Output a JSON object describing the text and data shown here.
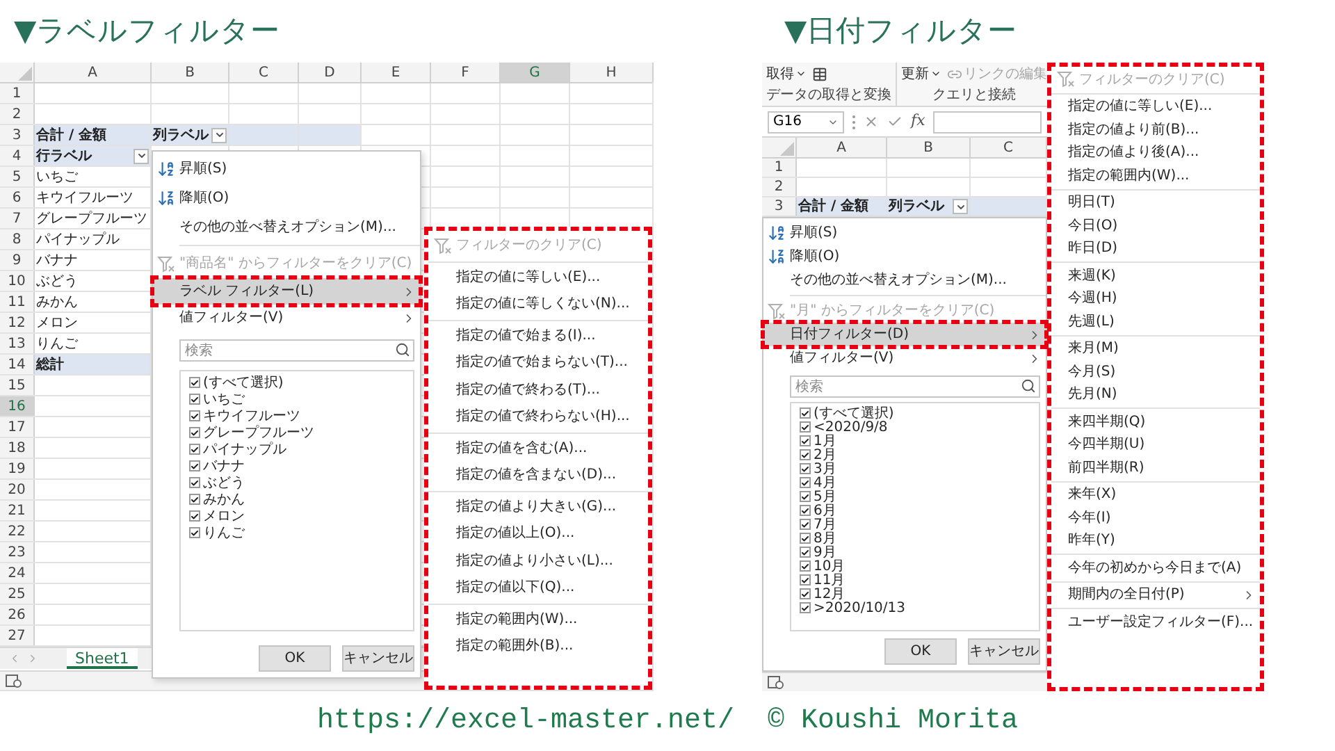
{
  "panels": [
    {
      "title": "▼ラベルフィルター",
      "columns": [
        {
          "label": "A",
          "selected": false
        },
        {
          "label": "B",
          "selected": false
        },
        {
          "label": "C",
          "selected": false
        },
        {
          "label": "D",
          "selected": false
        },
        {
          "label": "E",
          "selected": false
        },
        {
          "label": "F",
          "selected": false
        },
        {
          "label": "G",
          "selected": true
        },
        {
          "label": "H",
          "selected": false
        }
      ],
      "rows": [
        {
          "number": "1",
          "selected": false,
          "kind": "blank",
          "cells": []
        },
        {
          "number": "2",
          "selected": false,
          "kind": "blank",
          "cells": []
        },
        {
          "number": "3",
          "selected": false,
          "kind": "column_header",
          "cells": [
            {
              "text": "合計 / 金額",
              "dropdown": false
            },
            {
              "text": "列ラベル",
              "dropdown": true
            }
          ]
        },
        {
          "number": "4",
          "selected": false,
          "kind": "row_header",
          "cells": [
            {
              "text": "行ラベル",
              "dropdown": true
            }
          ]
        },
        {
          "number": "5",
          "selected": false,
          "kind": "item",
          "cells": [
            {
              "text": "いちご",
              "dropdown": false
            }
          ]
        },
        {
          "number": "6",
          "selected": false,
          "kind": "item",
          "cells": [
            {
              "text": "キウイフルーツ",
              "dropdown": false
            }
          ]
        },
        {
          "number": "7",
          "selected": false,
          "kind": "item",
          "cells": [
            {
              "text": "グレープフルーツ",
              "dropdown": false
            }
          ]
        },
        {
          "number": "8",
          "selected": false,
          "kind": "item",
          "cells": [
            {
              "text": "パイナップル",
              "dropdown": false
            }
          ]
        },
        {
          "number": "9",
          "selected": false,
          "kind": "item",
          "cells": [
            {
              "text": "バナナ",
              "dropdown": false
            }
          ]
        },
        {
          "number": "10",
          "selected": false,
          "kind": "item",
          "cells": [
            {
              "text": "ぶどう",
              "dropdown": false
            }
          ]
        },
        {
          "number": "11",
          "selected": false,
          "kind": "item",
          "cells": [
            {
              "text": "みかん",
              "dropdown": false
            }
          ]
        },
        {
          "number": "12",
          "selected": false,
          "kind": "item",
          "cells": [
            {
              "text": "メロン",
              "dropdown": false
            }
          ]
        },
        {
          "number": "13",
          "selected": false,
          "kind": "item",
          "cells": [
            {
              "text": "りんご",
              "dropdown": false
            }
          ]
        },
        {
          "number": "14",
          "selected": false,
          "kind": "total",
          "cells": [
            {
              "text": "総計",
              "dropdown": false
            }
          ]
        },
        {
          "number": "15",
          "selected": false,
          "kind": "blank",
          "cells": []
        },
        {
          "number": "16",
          "selected": true,
          "kind": "blank",
          "cells": []
        },
        {
          "number": "17",
          "selected": false,
          "kind": "blank",
          "cells": []
        },
        {
          "number": "18",
          "selected": false,
          "kind": "blank",
          "cells": []
        },
        {
          "number": "19",
          "selected": false,
          "kind": "blank",
          "cells": []
        },
        {
          "number": "20",
          "selected": false,
          "kind": "blank",
          "cells": []
        },
        {
          "number": "21",
          "selected": false,
          "kind": "blank",
          "cells": []
        },
        {
          "number": "22",
          "selected": false,
          "kind": "blank",
          "cells": []
        },
        {
          "number": "23",
          "selected": false,
          "kind": "blank",
          "cells": []
        },
        {
          "number": "24",
          "selected": false,
          "kind": "blank",
          "cells": []
        },
        {
          "number": "25",
          "selected": false,
          "kind": "blank",
          "cells": []
        },
        {
          "number": "26",
          "selected": false,
          "kind": "blank",
          "cells": []
        },
        {
          "number": "27",
          "selected": false,
          "kind": "blank",
          "cells": []
        }
      ],
      "sheet_tabs": [
        {
          "label": "Sheet1",
          "selected": true
        }
      ],
      "menu": {
        "sort_items": [
          {
            "kind": "ascending",
            "label": "昇順(S)"
          },
          {
            "kind": "descending",
            "label": "降順(O)"
          },
          {
            "kind": "option",
            "label": "その他の並べ替えオプション(M)..."
          }
        ],
        "clear": {
          "label": "\"商品名\" からフィルターをクリア(C)",
          "disabled": true
        },
        "filters": [
          {
            "label": "ラベル フィルター(L)",
            "selected": true
          },
          {
            "label": "値フィルター(V)",
            "selected": false
          }
        ],
        "search": {
          "placeholder": "検索"
        },
        "values": [
          {
            "label": "(すべて選択)",
            "checked": true
          },
          {
            "label": "いちご",
            "checked": true
          },
          {
            "label": "キウイフルーツ",
            "checked": true
          },
          {
            "label": "グレープフルーツ",
            "checked": true
          },
          {
            "label": "パイナップル",
            "checked": true
          },
          {
            "label": "バナナ",
            "checked": true
          },
          {
            "label": "ぶどう",
            "checked": true
          },
          {
            "label": "みかん",
            "checked": true
          },
          {
            "label": "メロン",
            "checked": true
          },
          {
            "label": "りんご",
            "checked": true
          }
        ],
        "buttons": [
          "OK",
          "キャンセル"
        ]
      },
      "submenu": {
        "clear": {
          "label": "フィルターのクリア(C)",
          "disabled": true
        },
        "groups": [
          [
            {
              "label": "指定の値に等しい(E)...",
              "kind": "item"
            },
            {
              "label": "指定の値に等しくない(N)...",
              "kind": "item"
            }
          ],
          [
            {
              "label": "指定の値で始まる(I)...",
              "kind": "item"
            },
            {
              "label": "指定の値で始まらない(T)...",
              "kind": "item"
            },
            {
              "label": "指定の値で終わる(T)...",
              "kind": "item"
            },
            {
              "label": "指定の値で終わらない(H)...",
              "kind": "item"
            }
          ],
          [
            {
              "label": "指定の値を含む(A)...",
              "kind": "item"
            },
            {
              "label": "指定の値を含まない(D)...",
              "kind": "item"
            }
          ],
          [
            {
              "label": "指定の値より大きい(G)...",
              "kind": "item"
            },
            {
              "label": "指定の値以上(O)...",
              "kind": "item"
            },
            {
              "label": "指定の値より小さい(L)...",
              "kind": "item"
            },
            {
              "label": "指定の値以下(Q)...",
              "kind": "item"
            }
          ],
          [
            {
              "label": "指定の範囲内(W)...",
              "kind": "item"
            },
            {
              "label": "指定の範囲外(B)...",
              "kind": "item"
            }
          ]
        ]
      }
    },
    {
      "title": "▼日付フィルター",
      "ribbon": {
        "groups": [
          {
            "label": "データの取得と変換",
            "buttons": [
              {
                "kind": "dropdown",
                "label": "取得",
                "disabled": false
              },
              {
                "kind": "table",
                "disabled": false
              }
            ]
          },
          {
            "label": "クエリと接続",
            "buttons": [
              {
                "kind": "dropdown",
                "label": "更新",
                "disabled": false
              },
              {
                "kind": "link",
                "label": "リンクの編集",
                "disabled": true
              }
            ]
          }
        ]
      },
      "formula_bar": {
        "name_box": "G16",
        "function_label": "fx"
      },
      "columns": [
        {
          "label": "A",
          "selected": false
        },
        {
          "label": "B",
          "selected": false
        },
        {
          "label": "C",
          "selected": false
        }
      ],
      "rows": [
        {
          "number": "1",
          "selected": false,
          "kind": "blank",
          "cells": []
        },
        {
          "number": "2",
          "selected": false,
          "kind": "blank",
          "cells": []
        },
        {
          "number": "3",
          "selected": false,
          "kind": "column_header",
          "cells": [
            {
              "text": "合計 / 金額",
              "dropdown": false
            },
            {
              "text": "列ラベル",
              "dropdown": true
            }
          ]
        }
      ],
      "menu": {
        "sort_items": [
          {
            "kind": "ascending",
            "label": "昇順(S)"
          },
          {
            "kind": "descending",
            "label": "降順(O)"
          },
          {
            "kind": "option",
            "label": "その他の並べ替えオプション(M)..."
          }
        ],
        "clear": {
          "label": "\"月\" からフィルターをクリア(C)",
          "disabled": true
        },
        "filters": [
          {
            "label": "日付フィルター(D)",
            "selected": true
          },
          {
            "label": "値フィルター(V)",
            "selected": false
          }
        ],
        "search": {
          "placeholder": "検索"
        },
        "values": [
          {
            "label": "(すべて選択)",
            "checked": true
          },
          {
            "label": "<2020/9/8",
            "checked": true
          },
          {
            "label": "1月",
            "checked": true
          },
          {
            "label": "2月",
            "checked": true
          },
          {
            "label": "3月",
            "checked": true
          },
          {
            "label": "4月",
            "checked": true
          },
          {
            "label": "5月",
            "checked": true
          },
          {
            "label": "6月",
            "checked": true
          },
          {
            "label": "7月",
            "checked": true
          },
          {
            "label": "8月",
            "checked": true
          },
          {
            "label": "9月",
            "checked": true
          },
          {
            "label": "10月",
            "checked": true
          },
          {
            "label": "11月",
            "checked": true
          },
          {
            "label": "12月",
            "checked": true
          },
          {
            "label": ">2020/10/13",
            "checked": true
          }
        ],
        "buttons": [
          "OK",
          "キャンセル"
        ]
      },
      "submenu": {
        "clear": {
          "label": "フィルターのクリア(C)",
          "disabled": true
        },
        "groups": [
          [
            {
              "label": "指定の値に等しい(E)...",
              "kind": "item"
            },
            {
              "label": "指定の値より前(B)...",
              "kind": "item"
            },
            {
              "label": "指定の値より後(A)...",
              "kind": "item"
            },
            {
              "label": "指定の範囲内(W)...",
              "kind": "item"
            }
          ],
          [
            {
              "label": "明日(T)",
              "kind": "item"
            },
            {
              "label": "今日(O)",
              "kind": "item"
            },
            {
              "label": "昨日(D)",
              "kind": "item"
            }
          ],
          [
            {
              "label": "来週(K)",
              "kind": "item"
            },
            {
              "label": "今週(H)",
              "kind": "item"
            },
            {
              "label": "先週(L)",
              "kind": "item"
            }
          ],
          [
            {
              "label": "来月(M)",
              "kind": "item"
            },
            {
              "label": "今月(S)",
              "kind": "item"
            },
            {
              "label": "先月(N)",
              "kind": "item"
            }
          ],
          [
            {
              "label": "来四半期(Q)",
              "kind": "item"
            },
            {
              "label": "今四半期(U)",
              "kind": "item"
            },
            {
              "label": "前四半期(R)",
              "kind": "item"
            }
          ],
          [
            {
              "label": "来年(X)",
              "kind": "item"
            },
            {
              "label": "今年(I)",
              "kind": "item"
            },
            {
              "label": "昨年(Y)",
              "kind": "item"
            }
          ],
          [
            {
              "label": "今年の初めから今日まで(A)",
              "kind": "item"
            }
          ],
          [
            {
              "label": "期間内の全日付(P)",
              "kind": "submenu"
            }
          ],
          [
            {
              "label": "ユーザー設定フィルター(F)...",
              "kind": "item"
            }
          ]
        ]
      }
    }
  ],
  "footer": "https://excel-master.net/  © Koushi Morita"
}
